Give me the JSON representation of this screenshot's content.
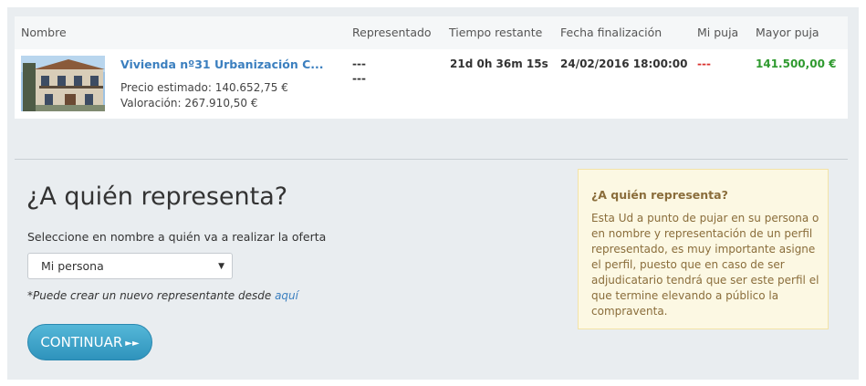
{
  "table": {
    "headers": {
      "nombre": "Nombre",
      "representado": "Representado",
      "tiempo": "Tiempo restante",
      "fecha": "Fecha finalización",
      "mi_puja": "Mi puja",
      "mayor_puja": "Mayor puja"
    },
    "row": {
      "title": "Vivienda nº31 Urbanización C...",
      "precio": "Precio estimado: 140.652,75 €",
      "valoracion": "Valoración: 267.910,50 €",
      "representado_1": "---",
      "representado_2": "---",
      "tiempo": "21d 0h 36m 15s",
      "fecha": "24/02/2016 18:00:00",
      "mi_puja": "---",
      "mayor_puja": "141.500,00 €"
    }
  },
  "form": {
    "heading": "¿A quién representa?",
    "label": "Seleccione en nombre a quién va a realizar la oferta",
    "select_value": "Mi persona",
    "note_text": "*Puede crear un nuevo representante desde ",
    "note_link": "aquí",
    "continue_label": "CONTINUAR"
  },
  "info": {
    "title": "¿A quién representa?",
    "body": "Esta Ud a punto de pujar en su persona o en nombre y representación de un perfil representado, es muy importante asigne el perfil, puesto que en caso de ser adjudicatario tendrá que ser este perfil el que termine elevando a público la compraventa."
  },
  "colors": {
    "link": "#3b7fbf",
    "mi_puja": "#d9302c",
    "mayor_puja": "#2f9a2f",
    "button": "#3ea4cb",
    "info_bg": "#fcf8e3"
  },
  "icons": {
    "select_arrow": "caret-down-icon",
    "continue": "double-chevron-right-icon"
  }
}
